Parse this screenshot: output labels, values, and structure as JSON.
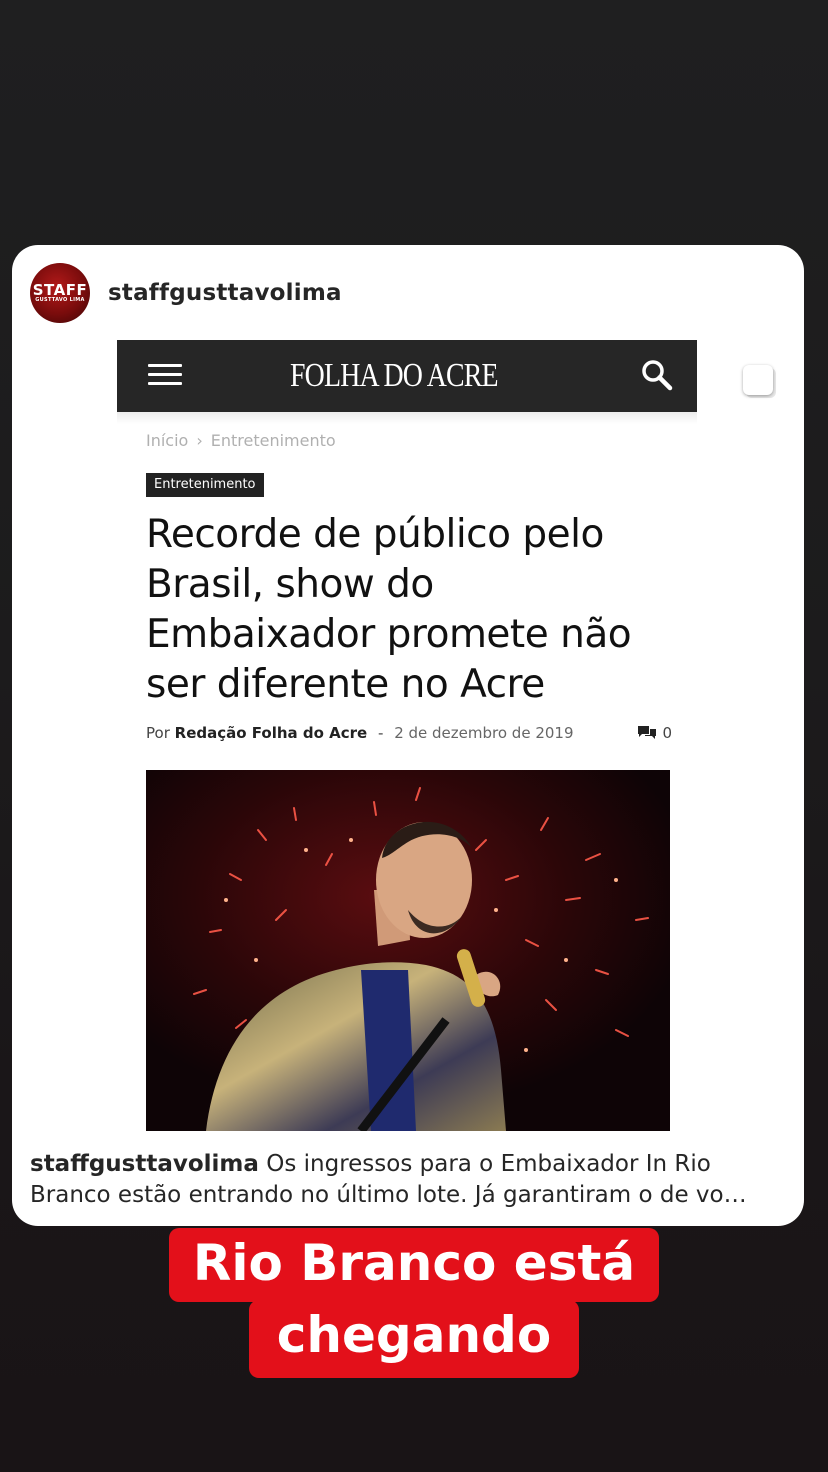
{
  "post": {
    "username": "staffgusttavolima",
    "avatar_text": {
      "line1": "STAFF",
      "line2": "GUSTTAVO LIMA"
    }
  },
  "article": {
    "site_name": "FOLHA DO ACRE",
    "breadcrumb": {
      "home": "Início",
      "separator": "›",
      "section": "Entretenimento"
    },
    "category": "Entretenimento",
    "headline_lines": [
      "Recorde de público pelo",
      "Brasil, show do",
      "Embaixador promete não",
      "ser diferente no Acre"
    ],
    "byline": {
      "prefix": "Por",
      "author": "Redação Folha do Acre",
      "separator": "-",
      "date": "2 de dezembro de 2019",
      "comment_count": "0"
    }
  },
  "caption": {
    "username": "staffgusttavolima",
    "line1_text": " Os ingressos para o Embaixador In Rio",
    "line2_text": "Branco estão entrando no último lote. Já garantiram o de vo…"
  },
  "story_text": {
    "line1": "Rio Branco está",
    "line2": "chegando"
  },
  "colors": {
    "background": "#1c1b1c",
    "story_highlight": "#e3101a",
    "site_nav": "#262626"
  },
  "icons": [
    "menu-icon",
    "globe-logo-icon",
    "search-icon",
    "comment-icon"
  ]
}
